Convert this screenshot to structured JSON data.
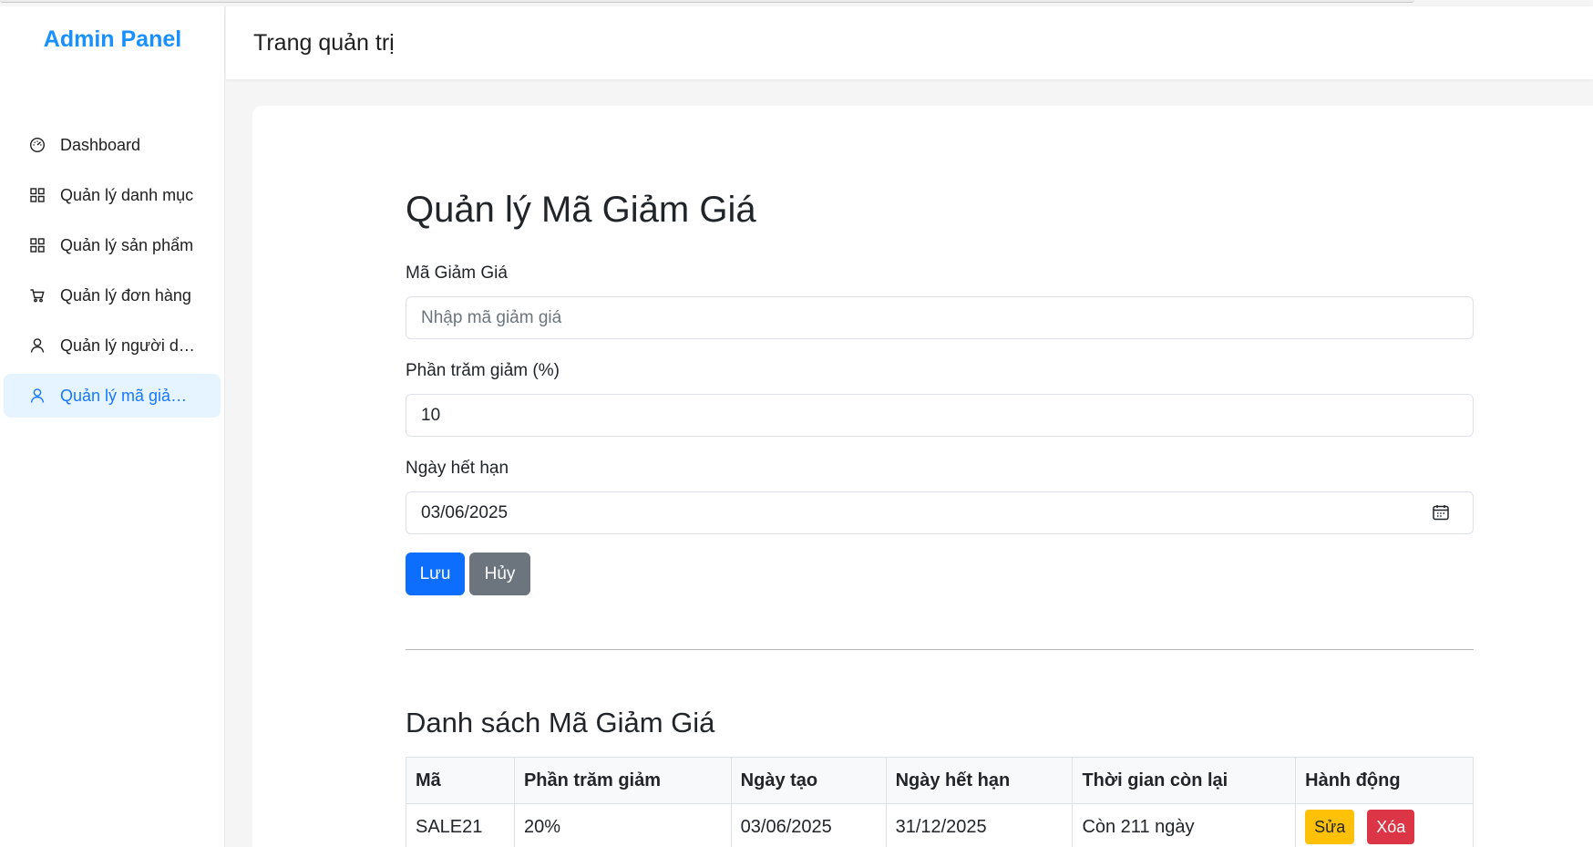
{
  "sidebar": {
    "brand": "Admin Panel",
    "items": [
      {
        "label": "Dashboard",
        "icon": "dashboard-icon"
      },
      {
        "label": "Quản lý danh mục",
        "icon": "grid-icon"
      },
      {
        "label": "Quản lý sản phẩm",
        "icon": "grid-icon"
      },
      {
        "label": "Quản lý đơn hàng",
        "icon": "cart-icon"
      },
      {
        "label": "Quản lý người dùng",
        "icon": "user-icon"
      },
      {
        "label": "Quản lý mã giảm giá",
        "icon": "user-icon",
        "active": true
      }
    ]
  },
  "header": {
    "title": "Trang quản trị"
  },
  "main": {
    "page_title": "Quản lý Mã Giảm Giá",
    "form": {
      "code_label": "Mã Giảm Giá",
      "code_placeholder": "Nhập mã giảm giá",
      "code_value": "",
      "percent_label": "Phần trăm giảm (%)",
      "percent_value": "10",
      "expiry_label": "Ngày hết hạn",
      "expiry_value": "03/06/2025",
      "save_label": "Lưu",
      "cancel_label": "Hủy"
    },
    "list_title": "Danh sách Mã Giảm Giá",
    "table": {
      "headers": [
        "Mã",
        "Phần trăm giảm",
        "Ngày tạo",
        "Ngày hết hạn",
        "Thời gian còn lại",
        "Hành động"
      ],
      "rows": [
        {
          "code": "SALE21",
          "percent": "20%",
          "created": "03/06/2025",
          "expiry": "31/12/2025",
          "remaining": "Còn 211 ngày",
          "edit_label": "Sửa",
          "delete_label": "Xóa"
        }
      ]
    }
  },
  "colors": {
    "brand": "#1890ff",
    "active_bg": "#e6f4ff",
    "active_text": "#1677ff",
    "primary": "#0d6efd",
    "secondary": "#6c757d",
    "warning": "#ffc107",
    "danger": "#dc3545"
  }
}
